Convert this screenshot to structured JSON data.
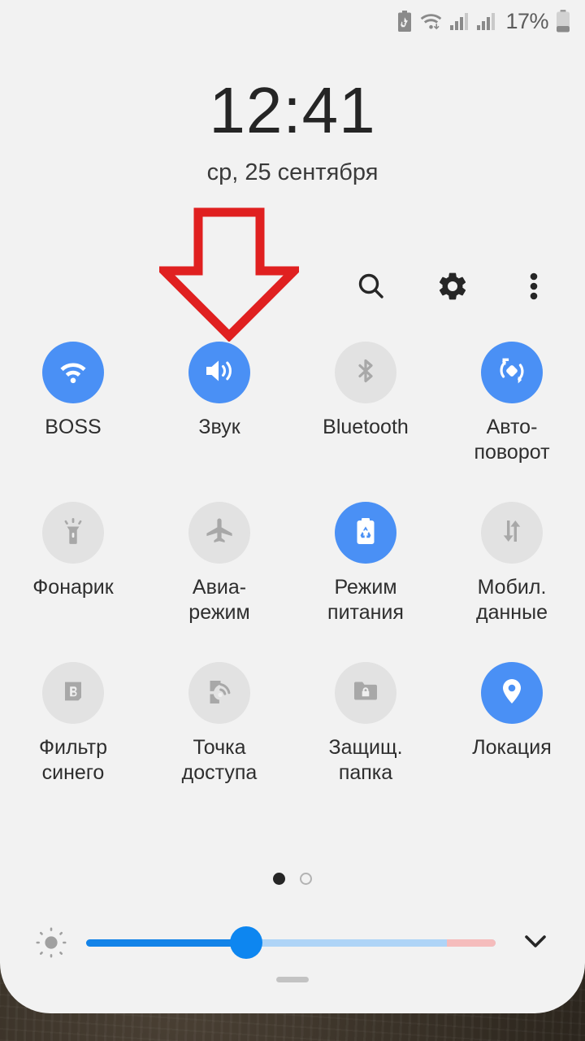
{
  "statusbar": {
    "icons": [
      "battery-saver-icon",
      "wifi-icon",
      "signal-sim1-icon",
      "signal-sim2-icon"
    ],
    "battery_percent": "17%",
    "battery_icon": "battery-low-icon"
  },
  "header": {
    "time": "12:41",
    "date": "ср, 25 сентября",
    "actions": [
      {
        "name": "search-icon",
        "label": "Поиск"
      },
      {
        "name": "gear-icon",
        "label": "Настройки"
      },
      {
        "name": "overflow-menu-icon",
        "label": "Ещё"
      }
    ]
  },
  "annotation": {
    "type": "arrow-down",
    "color": "#e02020",
    "points_to": "Звук"
  },
  "colors": {
    "accent_on": "#4a90f5",
    "tile_off": "#e2e2e2",
    "panel_bg": "#f2f2f2",
    "slider_fill": "#1383e8",
    "slider_track": "#aed4f7",
    "slider_warn": "#f5bcbc",
    "annotation_red": "#e02020"
  },
  "tiles": [
    {
      "label": "BOSS",
      "icon": "wifi-icon",
      "state": "on"
    },
    {
      "label": "Звук",
      "icon": "sound-icon",
      "state": "on"
    },
    {
      "label": "Bluetooth",
      "icon": "bluetooth-icon",
      "state": "off"
    },
    {
      "label": "Авто-\nповорот",
      "icon": "auto-rotate-icon",
      "state": "on"
    },
    {
      "label": "Фонарик",
      "icon": "flashlight-icon",
      "state": "off"
    },
    {
      "label": "Авиа-\nрежим",
      "icon": "airplane-icon",
      "state": "off"
    },
    {
      "label": "Режим\nпитания",
      "icon": "power-saving-icon",
      "state": "on"
    },
    {
      "label": "Мобил.\nданные",
      "icon": "mobile-data-icon",
      "state": "off"
    },
    {
      "label": "Фильтр\nсинего",
      "icon": "blue-light-filter-icon",
      "state": "off"
    },
    {
      "label": "Точка\nдоступа",
      "icon": "hotspot-icon",
      "state": "off"
    },
    {
      "label": "Защищ.\nпапка",
      "icon": "secure-folder-icon",
      "state": "off"
    },
    {
      "label": "Локация",
      "icon": "location-pin-icon",
      "state": "on"
    }
  ],
  "pager": {
    "pages": 2,
    "active_index": 0
  },
  "brightness": {
    "icon": "brightness-sun-icon",
    "value_percent": 39,
    "warn_zone_start_percent": 88,
    "expand_icon": "chevron-down-icon"
  },
  "panel_handle": {
    "name": "drag-handle"
  }
}
